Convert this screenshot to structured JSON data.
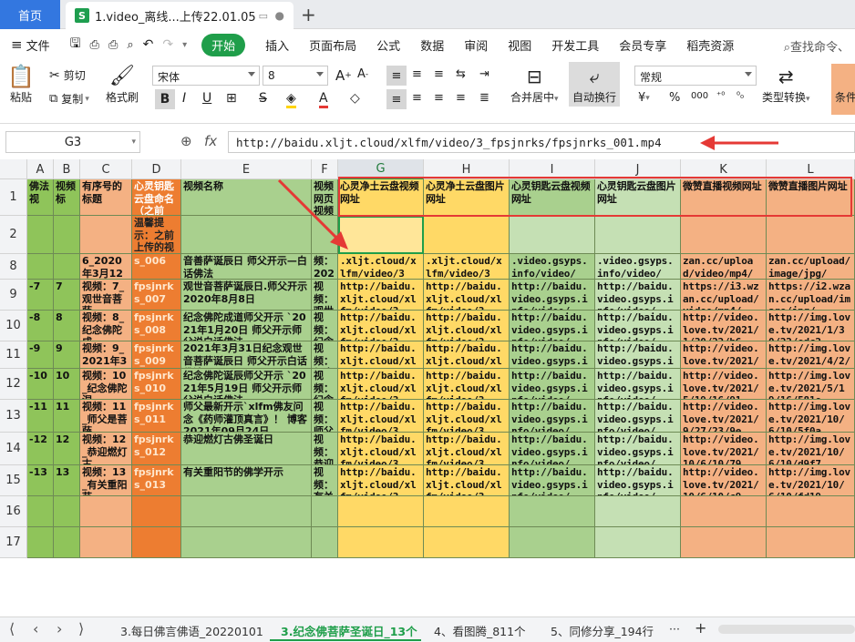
{
  "tabs": {
    "home": "首页",
    "doc_icon": "S",
    "doc": "1.video_离线...上传22.01.05",
    "new_tab": "+"
  },
  "menu": {
    "file": "文件",
    "items": [
      "开始",
      "插入",
      "页面布局",
      "公式",
      "数据",
      "审阅",
      "视图",
      "开发工具",
      "会员专享",
      "稻壳资源"
    ],
    "search": "查找命令、"
  },
  "ribbon": {
    "paste": "粘贴",
    "cut": "剪切",
    "copy": "复制",
    "format_painter": "格式刷",
    "font_name": "宋体",
    "font_size": "8",
    "merge": "合并居中",
    "wrap": "自动换行",
    "number_format": "常规",
    "type_convert": "类型转换",
    "cond": "条件",
    "currency": "¥",
    "percent": "%",
    "thousands": "000"
  },
  "formula_bar": {
    "cell_ref": "G3",
    "fx": "fx",
    "content": "http://baidu.xljt.cloud/xlfm/video/3_fpsjnrks/fpsjnrks_001.mp4"
  },
  "columns": [
    "A",
    "B",
    "C",
    "D",
    "E",
    "F",
    "G",
    "H",
    "I",
    "J",
    "K",
    "L"
  ],
  "rows": [
    {
      "num": "1",
      "cells": [
        "佛法视",
        "视频标",
        "有序号的标题",
        "心灵钥匙云盘命名（之前",
        "视频名称",
        "视频网页视频",
        "心灵净土云盘视频网址",
        "心灵净土云盘图片网址",
        "心灵钥匙云盘视频网址",
        "心灵钥匙云盘图片网址",
        "微赞直播视频网址",
        "微赞直播图片网址"
      ]
    },
    {
      "num": "2",
      "cells": [
        "",
        "",
        "",
        "温馨提示：之前上传的视",
        "",
        "",
        "",
        "",
        "",
        "",
        "",
        ""
      ]
    },
    {
      "num": "8",
      "cells": [
        "",
        "",
        "6_2020年3月12",
        "s_006",
        "音善萨诞辰日 师父开示—白话佛法",
        "频：202",
        ".xljt.cloud/xlfm/video/3",
        ".xljt.cloud/xlfm/video/3",
        ".video.gsyps.info/video/",
        ".video.gsyps.info/video/",
        "zan.cc/upload/video/mp4/",
        "zan.cc/upload/image/jpg/"
      ]
    },
    {
      "num": "9",
      "cells": [
        "-7",
        "7",
        "视频：7_观世音菩萨",
        "fpsjnrks_007",
        "观世音菩萨诞辰日.师父开示 2020年8月8日",
        "视频：观世",
        "http://baidu.xljt.cloud/xlfm/video/3",
        "http://baidu.xljt.cloud/xlfm/video/3",
        "http://baidu.video.gsyps.info/video/",
        "http://baidu.video.gsyps.info/video/",
        "https://i3.wzan.cc/upload/video/mp4/",
        "https://i2.wzan.cc/upload/image/jpg/"
      ]
    },
    {
      "num": "10",
      "cells": [
        "-8",
        "8",
        "视频：8_纪念佛陀成",
        "fpsjnrks_008",
        "纪念佛陀成道师父开示 `2021年1月20日 师父开示师父说白话佛法",
        "视频：纪念",
        "http://baidu.xljt.cloud/xlfm/video/3",
        "http://baidu.xljt.cloud/xlfm/video/3",
        "http://baidu.video.gsyps.info/video/",
        "http://baidu.video.gsyps.info/video/",
        "http://video.love.tv/2021/1/30/22/b6",
        "http://img.love.tv/2021/1/30/22/edc2"
      ]
    },
    {
      "num": "11",
      "cells": [
        "-9",
        "9",
        "视频：9_2021年3月31",
        "fpsjnrks_009",
        "2021年3月31日纪念观世音菩萨诞辰日 师父开示白话佛法",
        "视频：纪念",
        "http://baidu.xljt.cloud/xlfm/video/3",
        "http://baidu.xljt.cloud/xlfm/video/3",
        "http://baidu.video.gsyps.info/video/",
        "http://baidu.video.gsyps.info/video/",
        "http://video.love.tv/2021/4/2/9/bebf",
        "http://img.love.tv/2021/4/2/9/3965f1"
      ]
    },
    {
      "num": "12",
      "cells": [
        "-10",
        "10",
        "视频：10_纪念佛陀涅",
        "fpsjnrks_010",
        "纪念佛陀诞辰师父开示 `2021年5月19日 师父开示师父说白话佛法",
        "视频：纪念",
        "http://baidu.xljt.cloud/xlfm/video/3",
        "http://baidu.xljt.cloud/xlfm/video/3",
        "http://baidu.video.gsyps.info/video/",
        "http://baidu.video.gsyps.info/video/",
        "http://video.love.tv/2021/5/19/16/91",
        "http://img.love.tv/2021/5/19/16/581e"
      ]
    },
    {
      "num": "13",
      "cells": [
        "-11",
        "11",
        "视频：11_师父是菩萨",
        "fpsjnrks_011",
        "师父最新开示`xlfm佛友问念《药师灌顶真言》！ 博客 2021年09月24日",
        "视频：师父",
        "http://baidu.xljt.cloud/xlfm/video/3",
        "http://baidu.xljt.cloud/xlfm/video/3",
        "http://baidu.video.gsyps.info/video/",
        "http://baidu.video.gsyps.info/video/",
        "http://video.love.tv/2021/9/27/23/9e",
        "http://img.love.tv/2021/10/6/10/5f0a"
      ]
    },
    {
      "num": "14",
      "cells": [
        "-12",
        "12",
        "视频：12_恭迎燃灯古",
        "fpsjnrks_012",
        "恭迎燃灯古佛圣诞日",
        "视频：恭迎",
        "http://baidu.xljt.cloud/xlfm/video/3",
        "http://baidu.xljt.cloud/xlfm/video/3",
        "http://baidu.video.gsyps.info/video/",
        "http://baidu.video.gsyps.info/video/",
        "http://video.love.tv/2021/10/6/10/79",
        "http://img.love.tv/2021/10/6/10/d9f7"
      ]
    },
    {
      "num": "15",
      "cells": [
        "-13",
        "13",
        "视频：13_有关重阳节",
        "fpsjnrks_013",
        "有关重阳节的佛学开示",
        "视频：有关",
        "http://baidu.xljt.cloud/xlfm/video/3",
        "http://baidu.xljt.cloud/xlfm/video/3",
        "http://baidu.video.gsyps.info/video/",
        "http://baidu.video.gsyps.info/video/",
        "http://video.love.tv/2021/10/6/10/c9",
        "http://img.love.tv/2021/10/6/10/fd19"
      ]
    },
    {
      "num": "16",
      "cells": [
        "",
        "",
        "",
        "",
        "",
        "",
        "",
        "",
        "",
        "",
        "",
        ""
      ]
    },
    {
      "num": "17",
      "cells": [
        "",
        "",
        "",
        "",
        "",
        "",
        "",
        "",
        "",
        "",
        "",
        ""
      ]
    }
  ],
  "sheets": [
    "3.每日佛言佛语_20220101",
    "3.纪念佛菩萨圣诞日_13个",
    "4、看图腾_811个",
    "5、同修分享_194行"
  ],
  "sheet_nav": {
    "first": "⟨",
    "prev": "‹",
    "next": "›",
    "last": "⟩",
    "more": "···",
    "add": "+"
  },
  "colors": {
    "green": "#a7d18f",
    "orange": "#f4b183",
    "deep_orange": "#ed7d31",
    "yellow": "#ffd966",
    "light_green": "#c5e0b4",
    "accent": "#1f9e4a"
  }
}
